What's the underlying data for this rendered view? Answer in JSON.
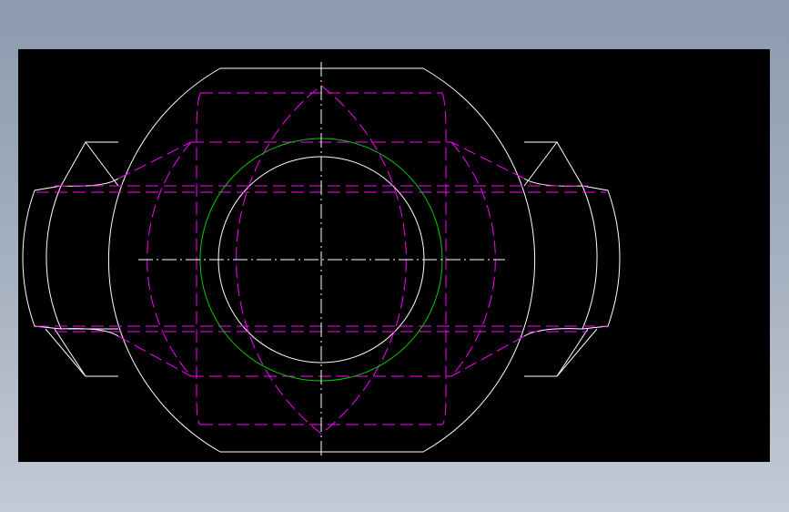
{
  "canvas": {
    "background": "#000000",
    "frame_gradient": [
      "#8b9aae",
      "#c3cad5"
    ]
  },
  "layers": {
    "outline": {
      "name": "visible-edges",
      "color": "#ffffff",
      "linetype": "continuous"
    },
    "hidden": {
      "name": "hidden-edges",
      "color": "#ff00ff",
      "linetype": "dashed"
    },
    "bore": {
      "name": "bore-circle",
      "color": "#00cc00",
      "linetype": "continuous"
    },
    "center": {
      "name": "center-lines",
      "color": "#ffffff",
      "linetype": "dash-dot"
    }
  }
}
